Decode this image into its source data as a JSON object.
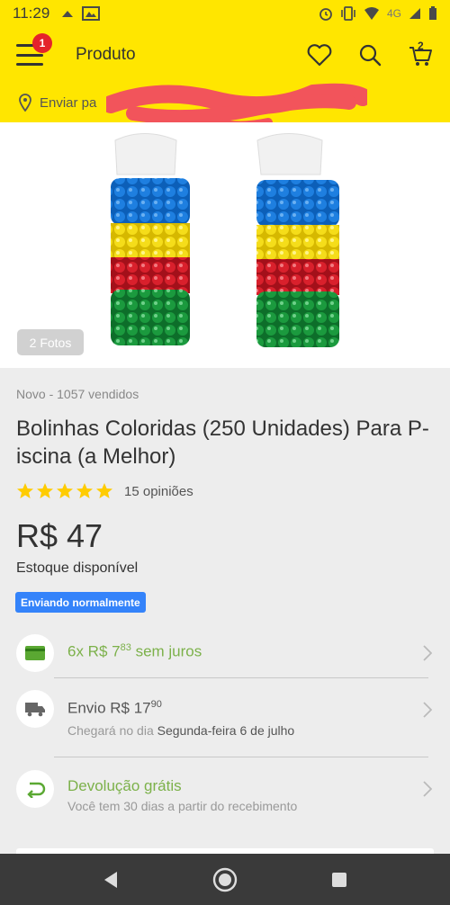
{
  "status_bar": {
    "time": "11:29",
    "network": "4G"
  },
  "app_bar": {
    "title": "Produto",
    "menu_badge": "1",
    "cart_count": "2"
  },
  "shipping_bar": {
    "text": "Enviar pa"
  },
  "gallery": {
    "photo_count": "2 Fotos"
  },
  "product": {
    "condition": "Novo - 1057 vendidos",
    "title": "Bolinhas Coloridas (250 Unidades) Para P-iscina (a Melhor)",
    "rating": 5,
    "reviews": "15 opiniões",
    "price": "R$ 47",
    "stock": "Estoque disponível",
    "shipping_badge": "Enviando normalmente"
  },
  "installments": {
    "prefix": "6x R$ 7",
    "cents": "83",
    "suffix": " sem juros"
  },
  "delivery": {
    "label": "Envio",
    "price": "R$ 17",
    "cents": "90",
    "arrival_prefix": "Chegará no dia",
    "arrival_date": "Segunda-feira 6 de julho"
  },
  "returns": {
    "title": "Devolução grátis",
    "subtitle": "Você tem 30 dias a partir do recebimento"
  },
  "colors": {
    "brand_yellow": "#ffe600",
    "accent_blue": "#3483fa",
    "green": "#7cb14a",
    "badge_red": "#e4232b"
  }
}
